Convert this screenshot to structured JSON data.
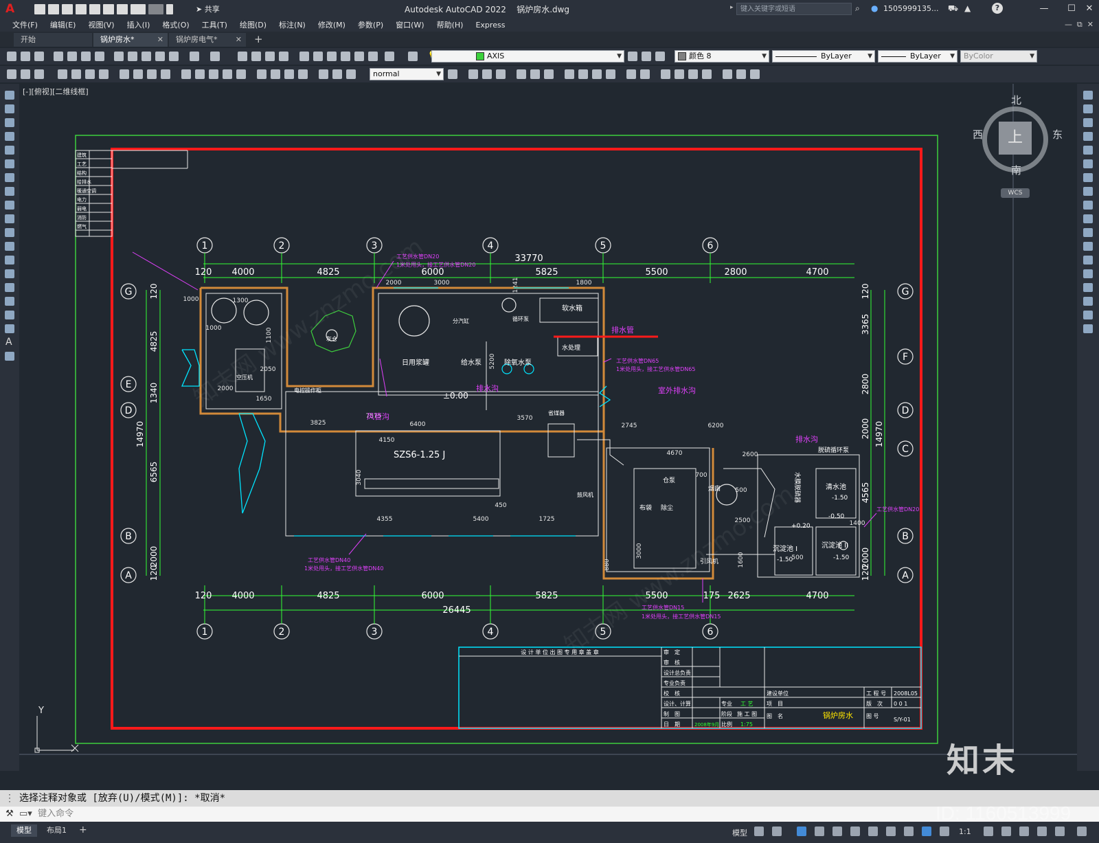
{
  "window": {
    "app_title": "Autodesk AutoCAD 2022",
    "file_title": "锅炉房水.dwg",
    "share_label": "共享",
    "search_placeholder": "键入关键字或短语",
    "user": "1505999135...",
    "help_icon": "question-icon"
  },
  "menu": [
    "文件(F)",
    "编辑(E)",
    "视图(V)",
    "插入(I)",
    "格式(O)",
    "工具(T)",
    "绘图(D)",
    "标注(N)",
    "修改(M)",
    "参数(P)",
    "窗口(W)",
    "帮助(H)",
    "Express"
  ],
  "tabs": [
    {
      "label": "开始",
      "active": false
    },
    {
      "label": "锅炉房水*",
      "active": true
    },
    {
      "label": "锅炉房电气*",
      "active": false
    }
  ],
  "toolbar": {
    "layer": "AXIS",
    "color": "颜色 8",
    "linetype": "ByLayer",
    "lineweight": "ByLayer",
    "plotstyle": "ByColor",
    "textstyle": "normal"
  },
  "viewport": {
    "label": "[-][俯视][二维线框]",
    "compass": {
      "north": "北",
      "south": "南",
      "east": "东",
      "west": "西",
      "top": "上",
      "wcs": "WCS"
    },
    "ucs_y": "Y",
    "watermark_logo": "知末",
    "watermark_id": "ID: 1160513999",
    "watermark_text": "知末网 www.znzmo.com"
  },
  "drawing": {
    "top_grid_labels": [
      "1",
      "2",
      "3",
      "4",
      "5",
      "6"
    ],
    "side_grid_labels_left": [
      "G",
      "E",
      "D",
      "B",
      "A"
    ],
    "side_grid_labels_right": [
      "G",
      "F",
      "D",
      "C",
      "B",
      "A"
    ],
    "top_total": "33770",
    "top_dims": [
      "120",
      "4000",
      "4825",
      "6000",
      "5825",
      "5500",
      "2800",
      "4700"
    ],
    "bottom_total": "26445",
    "bottom_dims": [
      "120",
      "4000",
      "4825",
      "6000",
      "5825",
      "5500",
      "175",
      "2625",
      "4700"
    ],
    "left_dims": [
      "120",
      "4825",
      "1340",
      "6565",
      "14970",
      "2000",
      "120"
    ],
    "right_dims": [
      "120",
      "3365",
      "2800",
      "2000",
      "14970",
      "4565",
      "2000",
      "120"
    ],
    "inner_dims": [
      "2000",
      "3000",
      "1800",
      "1000",
      "1300",
      "1000",
      "1100",
      "2050",
      "2000",
      "1650",
      "3825",
      "7575",
      "6400",
      "4150",
      "3040",
      "4355",
      "5400",
      "1725",
      "450",
      "3570",
      "2745",
      "6200",
      "2600",
      "500",
      "2500",
      "1600",
      "3000",
      "880",
      "700",
      "500",
      "1400",
      "5200",
      "1241",
      "4670",
      "365"
    ],
    "labels": [
      "锅炉房水",
      "SZS6-1.25 J",
      "软水箱",
      "水处理",
      "日用浆罐",
      "给水泵",
      "除氧水泵",
      "分汽缸",
      "循环泵",
      "排水管",
      "排水沟",
      "风管沟",
      "室外排水沟",
      "±0.00",
      "清水池",
      "沉淀池 I",
      "沉淀池 II",
      "脱硫循环泵",
      "引风机",
      "鼓风机",
      "省煤器",
      "除尘",
      "烟囱",
      "仓泵",
      "布袋",
      "空压机",
      "电控操作柜",
      "水膜脱硫器",
      "灰仓",
      "排水沟",
      "工艺供水管DN20",
      "1米处甩头，接工艺供水管DN20",
      "工艺供水管DN65",
      "1米处甩头，接工艺供水管DN65",
      "工艺供水管DN40",
      "1米处甩头，接工艺供水管DN40",
      "工艺供水管DN15",
      "1米处甩头，接工艺供水管DN15",
      "-1.50",
      "-0.50",
      "+0.20",
      "-1.50",
      "-1.50"
    ],
    "titleblock": {
      "header": "设 计 单 位 出 图 专 用 章 盖 章",
      "rows": [
        "审　定",
        "审　核",
        "设计总负责",
        "专业负责",
        "校　核",
        "设计、计算",
        "制　图",
        "日　期"
      ],
      "project_label": "建设单位",
      "project_no_label": "工 程 号",
      "project_no": "2008L05",
      "item_label": "项　目",
      "version_label": "版　次",
      "version": "0 0 1",
      "speciality_label": "专业",
      "speciality": "工 艺",
      "stage_label": "阶段",
      "stage": "施 工 图",
      "scale_label": "比例",
      "scale": "1:75",
      "date": "2008年9月",
      "drawing_name_label": "图　名",
      "drawing_name": "锅炉房水",
      "drawing_no_label": "图 号",
      "drawing_no": "S/Y-01"
    },
    "left_table_rows": [
      "建筑",
      "工艺",
      "结构",
      "给排水",
      "暖通空调",
      "电力",
      "弱电",
      "消防",
      "燃气"
    ]
  },
  "command": {
    "history": "选择注释对象或 [放弃(U)/模式(M)]: *取消*",
    "placeholder": "键入命令"
  },
  "status": {
    "tabs": [
      "模型",
      "布局1"
    ],
    "model_label": "模型",
    "scale": "1:1"
  },
  "colors": {
    "frame_green": "#3ecf3e",
    "frame_red": "#ff1a1a",
    "dims": "#33ff33",
    "walls": "#d28a3a",
    "annot": "#e040fb",
    "text_white": "#ffffff",
    "cyan": "#00e5ff"
  }
}
